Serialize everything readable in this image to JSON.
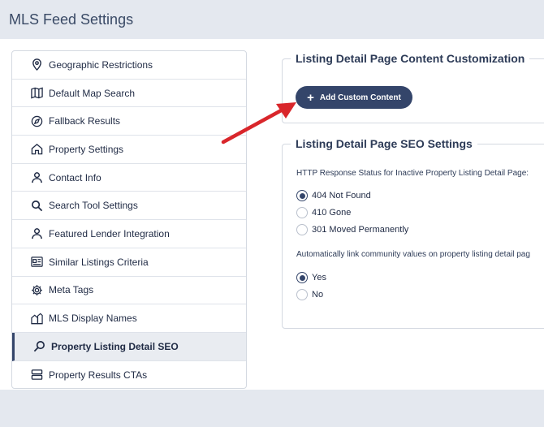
{
  "header": {
    "title": "MLS Feed Settings"
  },
  "sidebar": {
    "items": [
      {
        "label": "Geographic Restrictions",
        "icon": "map-pin-icon"
      },
      {
        "label": "Default Map Search",
        "icon": "map-icon"
      },
      {
        "label": "Fallback Results",
        "icon": "compass-icon"
      },
      {
        "label": "Property Settings",
        "icon": "home-icon"
      },
      {
        "label": "Contact Info",
        "icon": "user-icon"
      },
      {
        "label": "Search Tool Settings",
        "icon": "search-icon"
      },
      {
        "label": "Featured Lender Integration",
        "icon": "user-icon"
      },
      {
        "label": "Similar Listings Criteria",
        "icon": "listings-icon"
      },
      {
        "label": "Meta Tags",
        "icon": "gear-icon"
      },
      {
        "label": "MLS Display Names",
        "icon": "buildings-icon"
      },
      {
        "label": "Property Listing Detail SEO",
        "icon": "search-icon",
        "active": true
      },
      {
        "label": "Property Results CTAs",
        "icon": "stack-icon"
      }
    ]
  },
  "content_customization": {
    "legend": "Listing Detail Page Content Customization",
    "add_button_label": "Add Custom Content"
  },
  "seo_settings": {
    "legend": "Listing Detail Page SEO Settings",
    "status_question": "HTTP Response Status for Inactive Property Listing Detail Page:",
    "status_options": [
      "404 Not Found",
      "410 Gone",
      "301 Moved Permanently"
    ],
    "status_selected": "404 Not Found",
    "link_question": "Automatically link community values on property listing detail pag",
    "link_options": [
      "Yes",
      "No"
    ],
    "link_selected": "Yes"
  },
  "colors": {
    "accent": "#34456a",
    "annotation_arrow": "#d9262b",
    "page_bg": "#e4e8ef"
  }
}
